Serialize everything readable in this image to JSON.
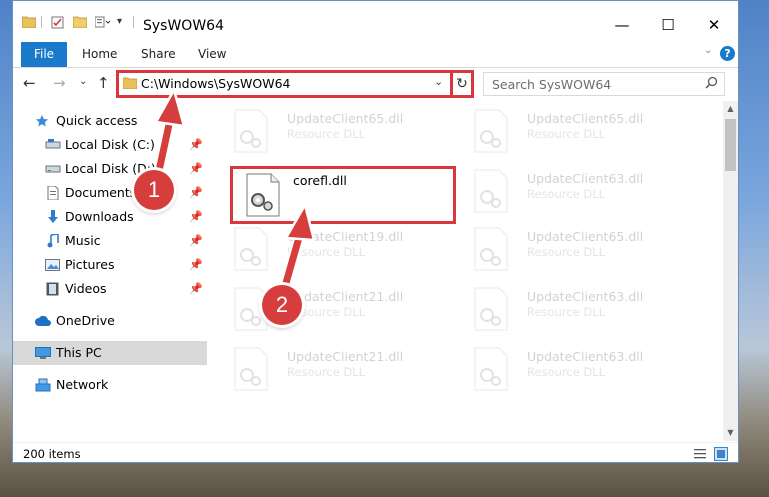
{
  "window": {
    "title": "SysWOW64",
    "minimize": "—",
    "maximize": "☐",
    "close": "✕"
  },
  "ribbon": {
    "file": "File",
    "home": "Home",
    "share": "Share",
    "view": "View",
    "help": "?"
  },
  "nav": {
    "back": "←",
    "forward": "→",
    "recent": "⌄",
    "up": "↑",
    "address": "C:\\Windows\\SysWOW64",
    "dropdown": "⌄",
    "refresh": "↻",
    "search_placeholder": "Search SysWOW64"
  },
  "sidebar": {
    "items": [
      {
        "label": "Quick access",
        "pinned": false
      },
      {
        "label": "Local Disk (C:)",
        "pinned": true
      },
      {
        "label": "Local Disk (D:)",
        "pinned": true
      },
      {
        "label": "Documents",
        "pinned": true
      },
      {
        "label": "Downloads",
        "pinned": true
      },
      {
        "label": "Music",
        "pinned": true
      },
      {
        "label": "Pictures",
        "pinned": true
      },
      {
        "label": "Videos",
        "pinned": true
      },
      {
        "label": "OneDrive",
        "pinned": false
      },
      {
        "label": "This PC",
        "pinned": false,
        "selected": true
      },
      {
        "label": "Network",
        "pinned": false
      }
    ]
  },
  "files": {
    "highlighted": {
      "name": "corefl.dll",
      "desc": ""
    },
    "ghost": [
      {
        "name": "UpdateClient65.dll",
        "desc": "Resource DLL"
      },
      {
        "name": "UpdateClient65.dll",
        "desc": "Resource DLL"
      },
      {
        "name": "UpdateClient63.dll",
        "desc": "Resource DLL"
      },
      {
        "name": "UpdateClient19.dll",
        "desc": "Resource DLL"
      },
      {
        "name": "UpdateClient65.dll",
        "desc": "Resource DLL"
      },
      {
        "name": "UpdateClient21.dll",
        "desc": "Resource DLL"
      },
      {
        "name": "UpdateClient63.dll",
        "desc": "Resource DLL"
      },
      {
        "name": "UpdateClient21.dll",
        "desc": "Resource DLL"
      },
      {
        "name": "UpdateClient63.dll",
        "desc": "Resource DLL"
      }
    ]
  },
  "status": {
    "count": "200 items"
  },
  "annotations": {
    "step1": "1",
    "step2": "2"
  },
  "colors": {
    "accent": "#1979ca",
    "highlight_red": "#d9363e",
    "badge_red": "#d63d3d"
  }
}
